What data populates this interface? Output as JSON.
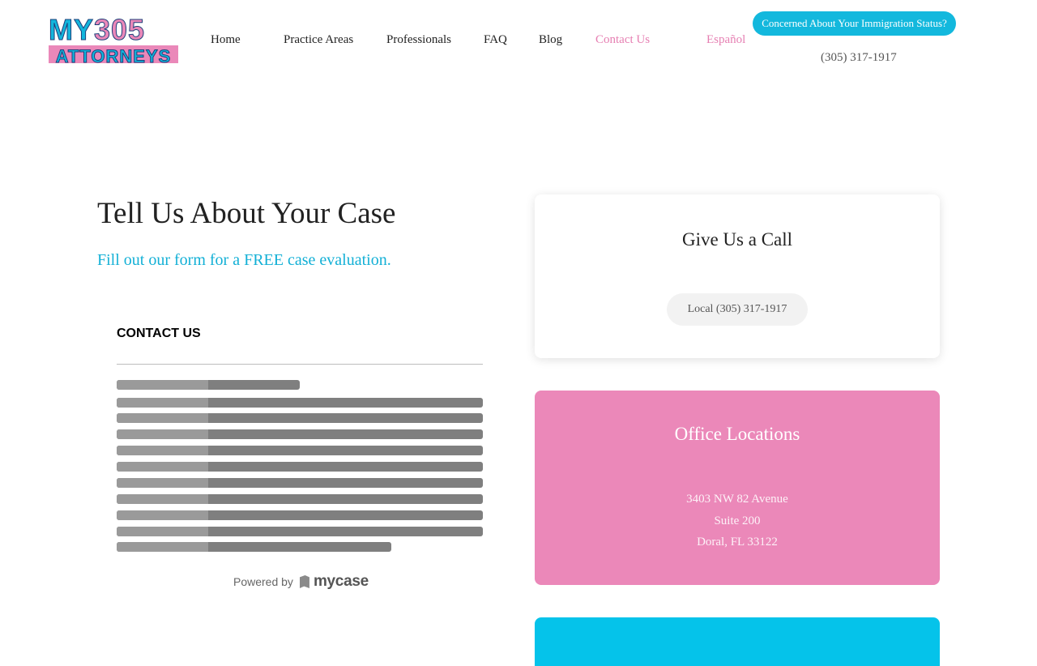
{
  "header": {
    "logo": {
      "line1_letters": "MY",
      "line1_number": "305",
      "line2": "ATTORNEYS"
    },
    "nav": [
      {
        "label": "Home"
      },
      {
        "label": "Practice Areas"
      },
      {
        "label": "Professionals"
      },
      {
        "label": "FAQ"
      },
      {
        "label": "Blog"
      },
      {
        "label": "Contact Us"
      },
      {
        "label": "Español"
      }
    ],
    "cta_label": "Concerned About Your Immigration Status?",
    "phone": "(305) 317-1917"
  },
  "main": {
    "heading": "Tell Us About Your Case",
    "subheading": "Fill out our form for a FREE case evaluation.",
    "form": {
      "title": "CONTACT US",
      "powered_by": "Powered by",
      "provider": "mycase"
    }
  },
  "sidebar": {
    "call_card": {
      "title": "Give Us a Call",
      "phone_label": "Local (305) 317-1917"
    },
    "locations_card": {
      "title": "Office Locations",
      "address_lines": [
        "3403 NW 82 Avenue",
        "Suite 200",
        "Doral, FL 33122"
      ]
    }
  },
  "colors": {
    "accent_blue": "#13b8dd",
    "accent_pink": "#eb88b9",
    "card_blue": "#05c3ea"
  }
}
